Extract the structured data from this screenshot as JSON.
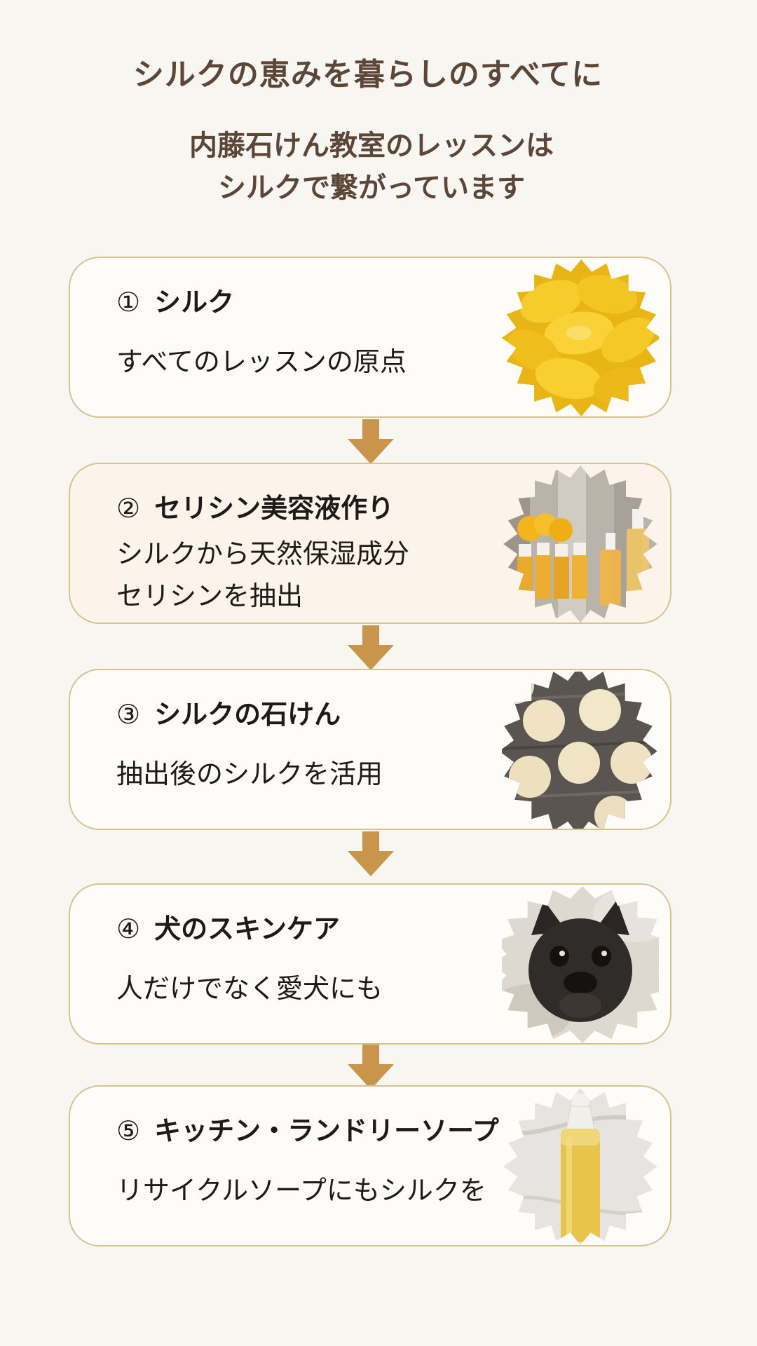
{
  "header": {
    "title": "シルクの恵みを暮らしのすべてに",
    "subtitle_lines": [
      "内藤石けん教室のレッスンは",
      "シルクで繋がっています"
    ]
  },
  "colors": {
    "background": "#f8f6f1",
    "heading": "#5b4637",
    "card_border": "#d7c391",
    "arrow": "#c9954b",
    "highlight_card": "#fcf3ea"
  },
  "steps": [
    {
      "num": "①",
      "title": "シルク",
      "desc": [
        "すべてのレッスンの原点"
      ],
      "image": "yellow-silk-cocoons"
    },
    {
      "num": "②",
      "title": "セリシン美容液作り",
      "desc": [
        "シルクから天然保湿成分",
        "セリシンを抽出"
      ],
      "image": "sericin-serum-bottles"
    },
    {
      "num": "③",
      "title": "シルクの石けん",
      "desc": [
        "抽出後のシルクを活用"
      ],
      "image": "round-silk-soaps"
    },
    {
      "num": "④",
      "title": "犬のスキンケア",
      "desc": [
        "人だけでなく愛犬にも"
      ],
      "image": "french-bulldog"
    },
    {
      "num": "⑤",
      "title": "キッチン・ランドリーソープ",
      "desc": [
        "リサイクルソープにもシルクを"
      ],
      "image": "liquid-soap-bottle"
    }
  ]
}
